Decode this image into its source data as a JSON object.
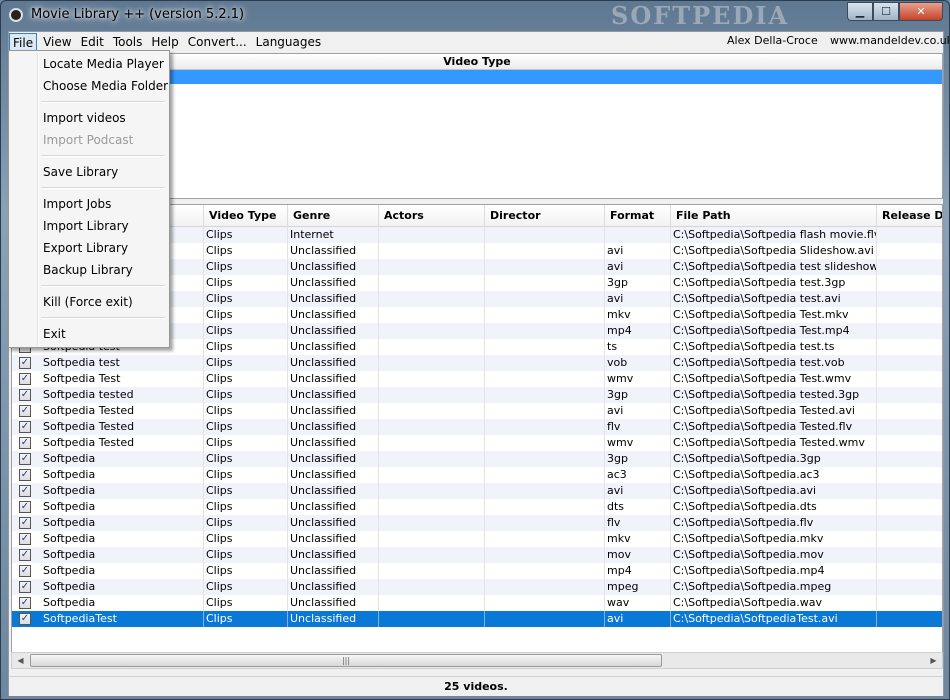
{
  "window": {
    "title": "Movie Library ++ (version 5.2.1)",
    "watermark": "SOFTPEDIA",
    "buttons": {
      "minimize": "▁",
      "maximize": "☐",
      "close": "✕"
    }
  },
  "menubar": {
    "items": [
      "File",
      "View",
      "Edit",
      "Tools",
      "Help",
      "Convert...",
      "Languages"
    ],
    "author": "Alex Della-Croce",
    "website": "www.mandeldev.co.uk"
  },
  "file_menu": {
    "items": [
      {
        "label": "Locate Media Player",
        "enabled": true
      },
      {
        "label": "Choose Media Folder",
        "enabled": true
      },
      {
        "sep": true
      },
      {
        "label": "Import videos",
        "enabled": true
      },
      {
        "label": "Import Podcast",
        "enabled": false
      },
      {
        "sep": true
      },
      {
        "label": "Save Library",
        "enabled": true
      },
      {
        "sep": true
      },
      {
        "label": "Import Jobs",
        "enabled": true
      },
      {
        "label": "Import Library",
        "enabled": true
      },
      {
        "label": "Export Library",
        "enabled": true
      },
      {
        "label": "Backup Library",
        "enabled": true
      },
      {
        "sep": true
      },
      {
        "label": "Kill (Force exit)",
        "enabled": true
      },
      {
        "sep": true
      },
      {
        "label": "Exit",
        "enabled": true
      }
    ]
  },
  "type_panel": {
    "header": "Video Type"
  },
  "table": {
    "columns": [
      "",
      "Video Type",
      "Genre",
      "Actors",
      "Director",
      "Format",
      "File Path",
      "Release Da"
    ],
    "rows": [
      {
        "checked": true,
        "title": "",
        "type": "Clips",
        "genre": "Internet",
        "actors": "",
        "director": "",
        "format": "",
        "path": "C:\\Softpedia\\Softpedia flash movie.flv"
      },
      {
        "checked": true,
        "title": "",
        "type": "Clips",
        "genre": "Unclassified",
        "actors": "",
        "director": "",
        "format": "avi",
        "path": "C:\\Softpedia\\Softpedia Slideshow.avi"
      },
      {
        "checked": true,
        "title": "",
        "type": "Clips",
        "genre": "Unclassified",
        "actors": "",
        "director": "",
        "format": "avi",
        "path": "C:\\Softpedia\\Softpedia test slideshow.avi"
      },
      {
        "checked": true,
        "title": "",
        "type": "Clips",
        "genre": "Unclassified",
        "actors": "",
        "director": "",
        "format": "3gp",
        "path": "C:\\Softpedia\\Softpedia test.3gp"
      },
      {
        "checked": true,
        "title": "",
        "type": "Clips",
        "genre": "Unclassified",
        "actors": "",
        "director": "",
        "format": "avi",
        "path": "C:\\Softpedia\\Softpedia test.avi"
      },
      {
        "checked": true,
        "title": "",
        "type": "Clips",
        "genre": "Unclassified",
        "actors": "",
        "director": "",
        "format": "mkv",
        "path": "C:\\Softpedia\\Softpedia Test.mkv"
      },
      {
        "checked": true,
        "title": "",
        "type": "Clips",
        "genre": "Unclassified",
        "actors": "",
        "director": "",
        "format": "mp4",
        "path": "C:\\Softpedia\\Softpedia Test.mp4"
      },
      {
        "checked": true,
        "title": "Softpedia test",
        "type": "Clips",
        "genre": "Unclassified",
        "actors": "",
        "director": "",
        "format": "ts",
        "path": "C:\\Softpedia\\Softpedia test.ts"
      },
      {
        "checked": true,
        "title": "Softpedia test",
        "type": "Clips",
        "genre": "Unclassified",
        "actors": "",
        "director": "",
        "format": "vob",
        "path": "C:\\Softpedia\\Softpedia test.vob"
      },
      {
        "checked": true,
        "title": "Softpedia Test",
        "type": "Clips",
        "genre": "Unclassified",
        "actors": "",
        "director": "",
        "format": "wmv",
        "path": "C:\\Softpedia\\Softpedia Test.wmv"
      },
      {
        "checked": true,
        "title": "Softpedia tested",
        "type": "Clips",
        "genre": "Unclassified",
        "actors": "",
        "director": "",
        "format": "3gp",
        "path": "C:\\Softpedia\\Softpedia tested.3gp"
      },
      {
        "checked": true,
        "title": "Softpedia Tested",
        "type": "Clips",
        "genre": "Unclassified",
        "actors": "",
        "director": "",
        "format": "avi",
        "path": "C:\\Softpedia\\Softpedia Tested.avi"
      },
      {
        "checked": true,
        "title": "Softpedia Tested",
        "type": "Clips",
        "genre": "Unclassified",
        "actors": "",
        "director": "",
        "format": "flv",
        "path": "C:\\Softpedia\\Softpedia Tested.flv"
      },
      {
        "checked": true,
        "title": "Softpedia Tested",
        "type": "Clips",
        "genre": "Unclassified",
        "actors": "",
        "director": "",
        "format": "wmv",
        "path": "C:\\Softpedia\\Softpedia Tested.wmv"
      },
      {
        "checked": true,
        "title": "Softpedia",
        "type": "Clips",
        "genre": "Unclassified",
        "actors": "",
        "director": "",
        "format": "3gp",
        "path": "C:\\Softpedia\\Softpedia.3gp"
      },
      {
        "checked": true,
        "title": "Softpedia",
        "type": "Clips",
        "genre": "Unclassified",
        "actors": "",
        "director": "",
        "format": "ac3",
        "path": "C:\\Softpedia\\Softpedia.ac3"
      },
      {
        "checked": true,
        "title": "Softpedia",
        "type": "Clips",
        "genre": "Unclassified",
        "actors": "",
        "director": "",
        "format": "avi",
        "path": "C:\\Softpedia\\Softpedia.avi"
      },
      {
        "checked": true,
        "title": "Softpedia",
        "type": "Clips",
        "genre": "Unclassified",
        "actors": "",
        "director": "",
        "format": "dts",
        "path": "C:\\Softpedia\\Softpedia.dts"
      },
      {
        "checked": true,
        "title": "Softpedia",
        "type": "Clips",
        "genre": "Unclassified",
        "actors": "",
        "director": "",
        "format": "flv",
        "path": "C:\\Softpedia\\Softpedia.flv"
      },
      {
        "checked": true,
        "title": "Softpedia",
        "type": "Clips",
        "genre": "Unclassified",
        "actors": "",
        "director": "",
        "format": "mkv",
        "path": "C:\\Softpedia\\Softpedia.mkv"
      },
      {
        "checked": true,
        "title": "Softpedia",
        "type": "Clips",
        "genre": "Unclassified",
        "actors": "",
        "director": "",
        "format": "mov",
        "path": "C:\\Softpedia\\Softpedia.mov"
      },
      {
        "checked": true,
        "title": "Softpedia",
        "type": "Clips",
        "genre": "Unclassified",
        "actors": "",
        "director": "",
        "format": "mp4",
        "path": "C:\\Softpedia\\Softpedia.mp4"
      },
      {
        "checked": true,
        "title": "Softpedia",
        "type": "Clips",
        "genre": "Unclassified",
        "actors": "",
        "director": "",
        "format": "mpeg",
        "path": "C:\\Softpedia\\Softpedia.mpeg"
      },
      {
        "checked": true,
        "title": "Softpedia",
        "type": "Clips",
        "genre": "Unclassified",
        "actors": "",
        "director": "",
        "format": "wav",
        "path": "C:\\Softpedia\\Softpedia.wav"
      },
      {
        "checked": true,
        "title": "SoftpediaTest",
        "type": "Clips",
        "genre": "Unclassified",
        "actors": "",
        "director": "",
        "format": "avi",
        "path": "C:\\Softpedia\\SoftpediaTest.avi",
        "selected": true
      }
    ]
  },
  "status": {
    "text": "25 videos."
  },
  "scrollbar": {
    "left_arrow": "◀",
    "right_arrow": "▶",
    "grip": "|||"
  },
  "checkmark": "✓"
}
